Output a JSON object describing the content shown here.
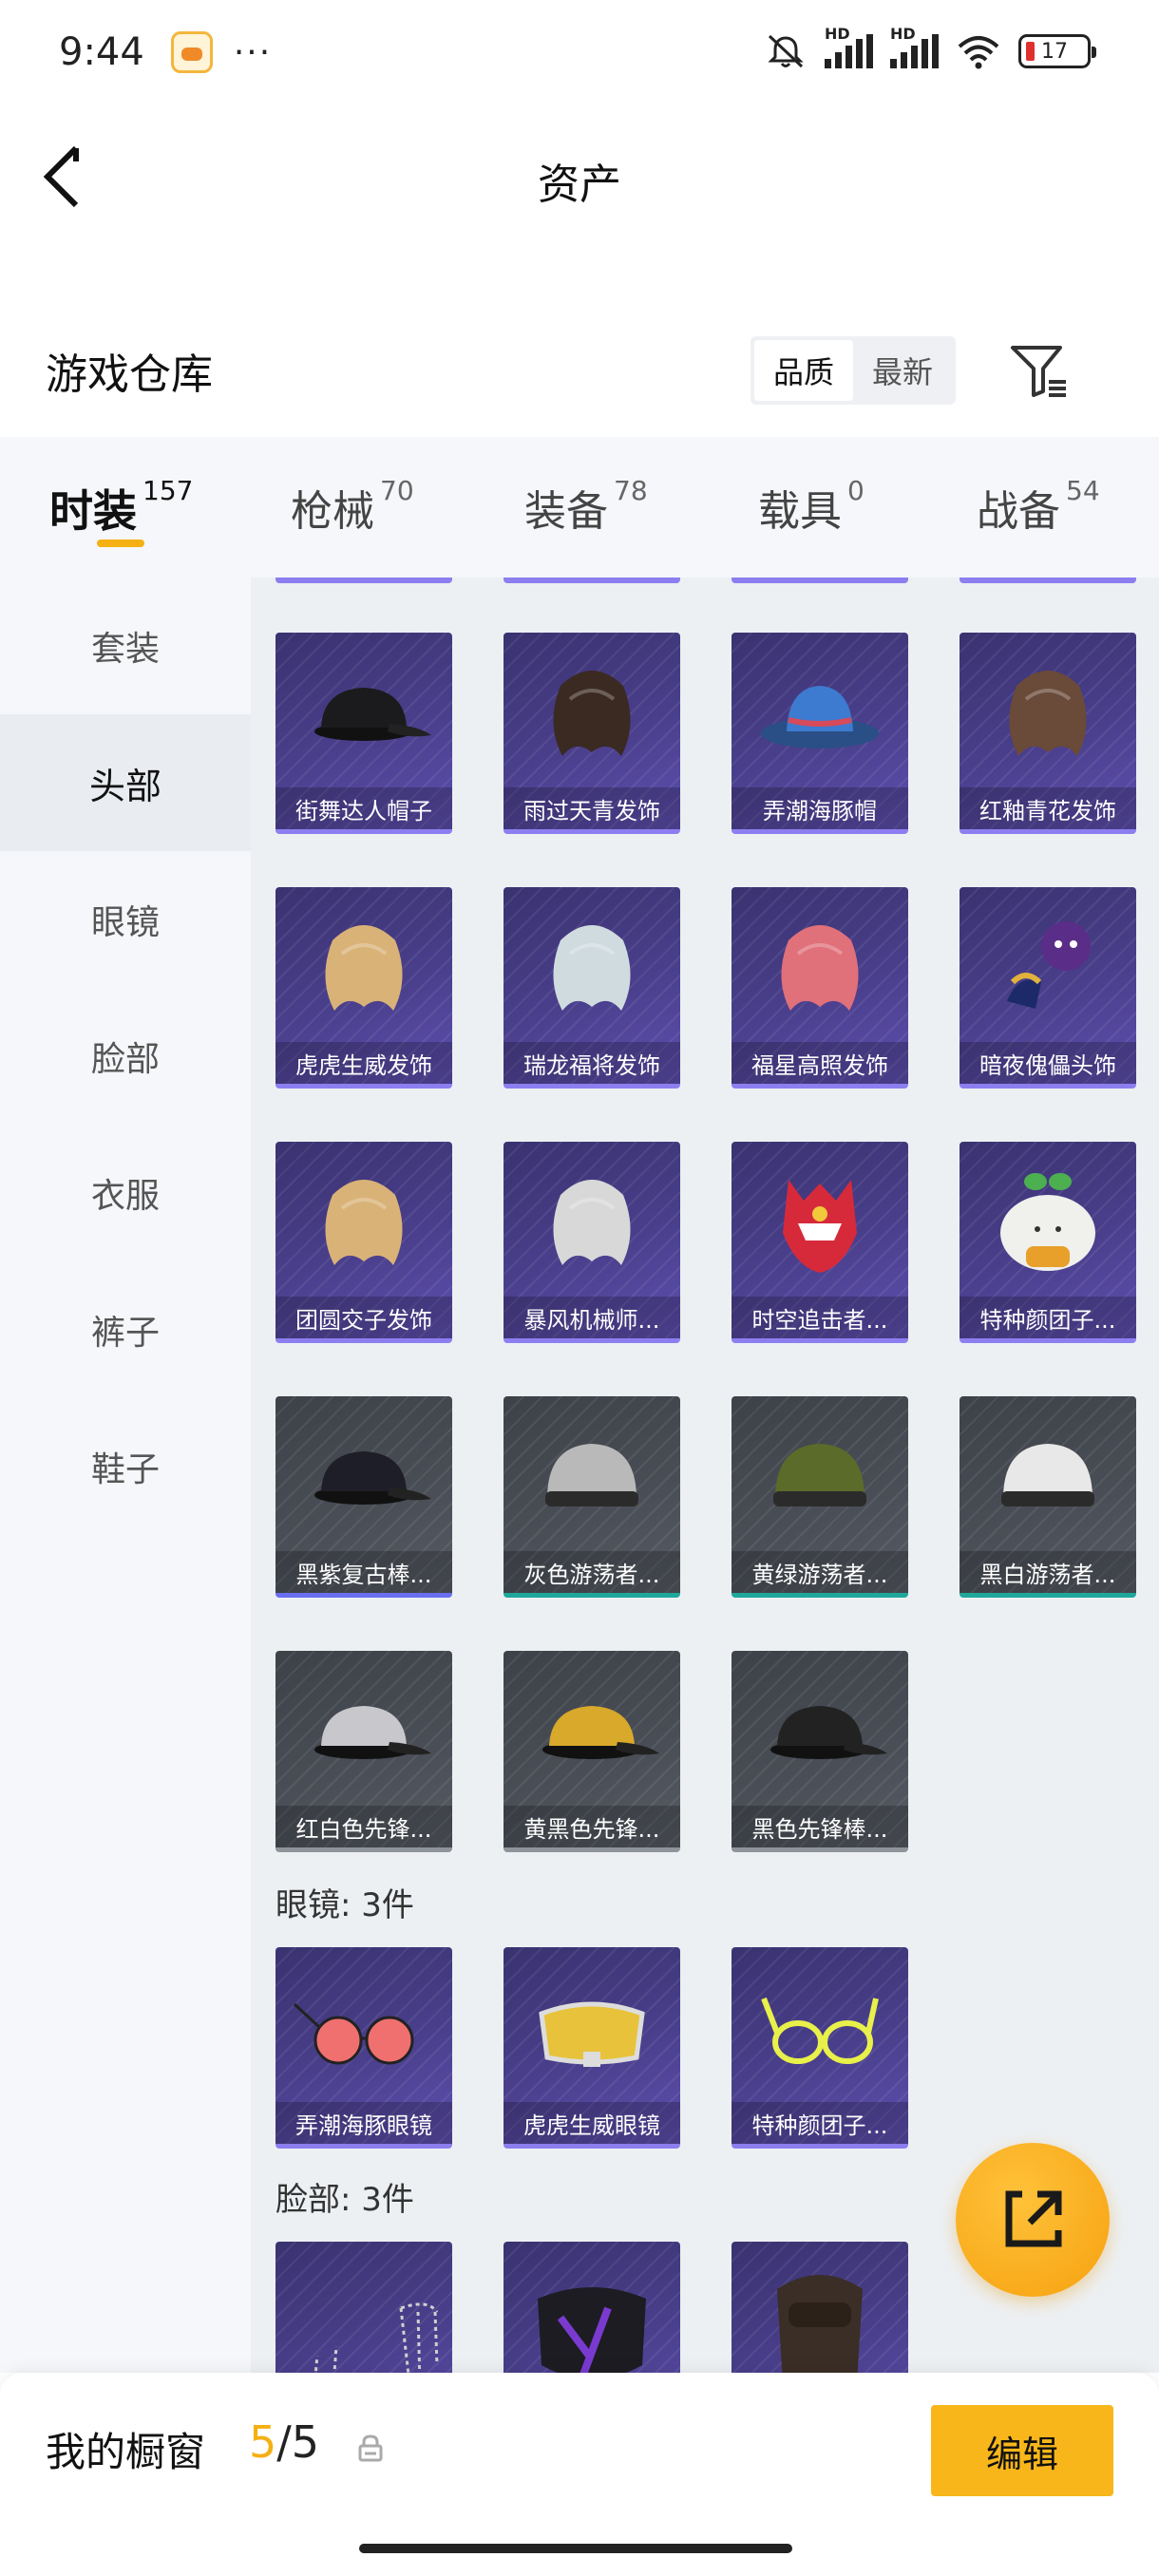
{
  "status_bar": {
    "time": "9:44",
    "more": "···",
    "battery": "17",
    "hd1": "HD",
    "hd2": "HD"
  },
  "header": {
    "title": "资产"
  },
  "warehouse": {
    "title": "游戏仓库",
    "sort_options": [
      "品质",
      "最新"
    ]
  },
  "category_tabs": [
    {
      "label": "时装",
      "count": "157",
      "active": true
    },
    {
      "label": "枪械",
      "count": "70"
    },
    {
      "label": "装备",
      "count": "78"
    },
    {
      "label": "载具",
      "count": "0"
    },
    {
      "label": "战备",
      "count": "54"
    }
  ],
  "sidebar": [
    {
      "label": "套装"
    },
    {
      "label": "头部",
      "active": true
    },
    {
      "label": "眼镜"
    },
    {
      "label": "脸部"
    },
    {
      "label": "衣服"
    },
    {
      "label": "裤子"
    },
    {
      "label": "鞋子"
    }
  ],
  "head_items": [
    {
      "name": "街舞达人帽子",
      "rarity": "purple",
      "icon": "cap-icon"
    },
    {
      "name": "雨过天青发饰",
      "rarity": "purple",
      "icon": "hair-icon"
    },
    {
      "name": "弄潮海豚帽",
      "rarity": "purple",
      "icon": "bucket-hat-icon"
    },
    {
      "name": "红釉青花发饰",
      "rarity": "purple",
      "icon": "hair-icon"
    },
    {
      "name": "虎虎生威发饰",
      "rarity": "purple",
      "icon": "hair-icon"
    },
    {
      "name": "瑞龙福将发饰",
      "rarity": "purple",
      "icon": "hair-icon"
    },
    {
      "name": "福星高照发饰",
      "rarity": "purple",
      "icon": "hair-icon"
    },
    {
      "name": "暗夜傀儡头饰",
      "rarity": "purple",
      "icon": "puppet-icon"
    },
    {
      "name": "团圆交子发饰",
      "rarity": "purple",
      "icon": "hair-icon"
    },
    {
      "name": "暴风机械师...",
      "rarity": "purple",
      "icon": "hair-icon"
    },
    {
      "name": "时空追击者...",
      "rarity": "purple",
      "icon": "helmet-icon"
    },
    {
      "name": "特种颜团子...",
      "rarity": "purple",
      "icon": "dumpling-icon"
    },
    {
      "name": "黑紫复古棒...",
      "rarity": "grey",
      "icon": "cap-icon"
    },
    {
      "name": "灰色游荡者...",
      "rarity": "grey",
      "icon": "beanie-icon"
    },
    {
      "name": "黄绿游荡者...",
      "rarity": "grey",
      "icon": "beanie-icon"
    },
    {
      "name": "黑白游荡者...",
      "rarity": "grey",
      "icon": "beanie-icon"
    },
    {
      "name": "红白色先锋...",
      "rarity": "grey",
      "icon": "cap-icon"
    },
    {
      "name": "黄黑色先锋...",
      "rarity": "grey",
      "icon": "cap-icon"
    },
    {
      "name": "黑色先锋棒...",
      "rarity": "grey",
      "icon": "cap-icon"
    }
  ],
  "glasses_section": {
    "label": "眼镜: 3件"
  },
  "glasses_items": [
    {
      "name": "弄潮海豚眼镜",
      "icon": "sunglasses-icon"
    },
    {
      "name": "虎虎生威眼镜",
      "icon": "goggles-icon"
    },
    {
      "name": "特种颜团子...",
      "icon": "glasses-icon"
    }
  ],
  "face_section": {
    "label": "脸部: 3件"
  },
  "face_items": [
    {
      "name": "",
      "icon": "face-chain-icon"
    },
    {
      "name": "",
      "icon": "mask-icon"
    },
    {
      "name": "",
      "icon": "respirator-icon"
    }
  ],
  "showcase": {
    "label": "我的橱窗",
    "current": "5",
    "separator": "/",
    "total": "5",
    "edit_label": "编辑"
  },
  "colors": {
    "accent": "#f5b014",
    "purple_rarity": "#8d7ef0",
    "grey_rarity": "#8f949b"
  }
}
